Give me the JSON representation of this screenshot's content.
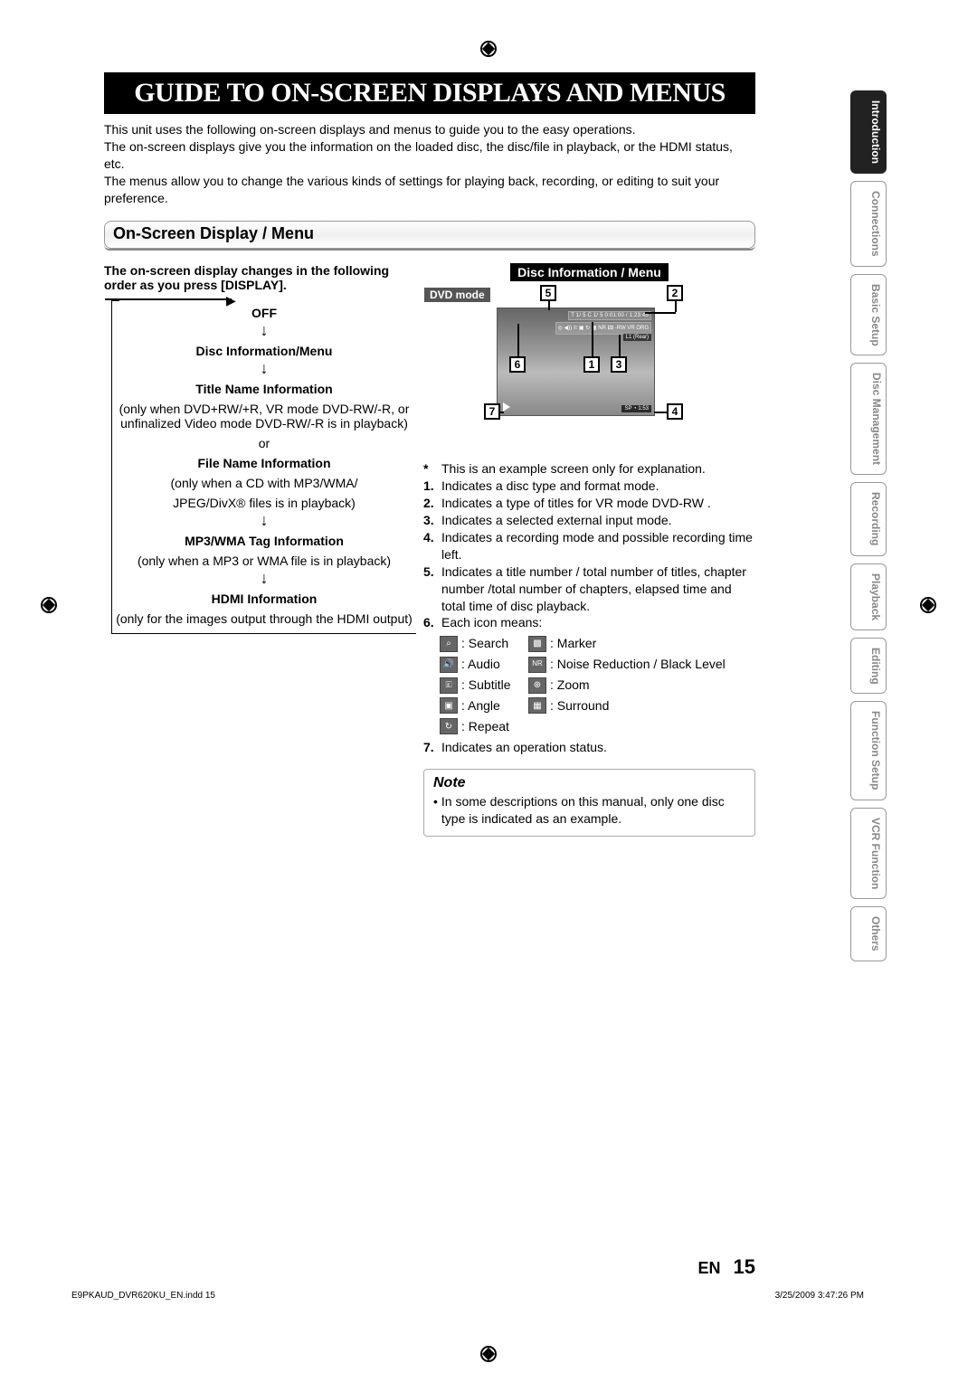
{
  "title": "GUIDE TO ON-SCREEN DISPLAYS AND MENUS",
  "intro": {
    "l1": "This unit uses the following on-screen displays and menus to guide you to the easy operations.",
    "l2": "The on-screen displays give you the information on the loaded disc, the disc/file in playback, or the HDMI status, etc.",
    "l3": "The menus allow you to change the various kinds of settings for playing back, recording, or editing to suit your preference."
  },
  "section_title": "On-Screen Display / Menu",
  "lead": "The on-screen display changes in the following order as you press [DISPLAY].",
  "flow": {
    "off": "OFF",
    "disc_info": "Disc Information/Menu",
    "title_name": "Title Name Information",
    "title_note": "(only when DVD+RW/+R, VR mode DVD-RW/-R, or unfinalized Video mode DVD-RW/-R is in playback)",
    "or": "or",
    "file_name": "File Name Information",
    "file_note1": "(only when a CD with MP3/WMA/",
    "file_note2": "JPEG/DivX® files is in playback)",
    "mp3": "MP3/WMA Tag Information",
    "mp3_note": "(only when a MP3 or WMA file is in playback)",
    "hdmi": "HDMI Information",
    "hdmi_note": "(only for the images output through the HDMI output)"
  },
  "diagram": {
    "header": "Disc Information / Menu",
    "mode": "DVD mode",
    "bar1": "T   1/   5  C   1/   5        0:01:00 / 1:23:45",
    "bar2": "◎ ◀)) 🗉 ▣ ↻ ▦ NR 🖽   -RW  VR  ORG",
    "bar3": "L1 (Rear)",
    "bar4": "SP   ◔   1:53",
    "star_note": "This is an example screen only for explanation.",
    "items": [
      "Indicates a disc type and format mode.",
      "Indicates a type of titles for VR mode DVD-RW .",
      "Indicates a selected external input mode.",
      "Indicates a recording mode and possible recording time left.",
      "Indicates a title number / total number of titles, chapter number /total number of chapters, elapsed time and total time of disc playback.",
      "Each icon means:"
    ],
    "item7": "Indicates an operation status."
  },
  "icons": {
    "search": ": Search",
    "marker": ": Marker",
    "audio": ": Audio",
    "nr": ": Noise Reduction / Black Level",
    "subtitle": ": Subtitle",
    "zoom": ": Zoom",
    "angle": ": Angle",
    "surround": ": Surround",
    "repeat": ": Repeat"
  },
  "note": {
    "title": "Note",
    "body": "In some descriptions on this manual, only one disc type is indicated as an example."
  },
  "side_tabs": [
    "Introduction",
    "Connections",
    "Basic Setup",
    "Disc Management",
    "Recording",
    "Playback",
    "Editing",
    "Function Setup",
    "VCR Function",
    "Others"
  ],
  "page_lang": "EN",
  "page_no": "15",
  "footer_left": "E9PKAUD_DVR620KU_EN.indd   15",
  "footer_right": "3/25/2009   3:47:26 PM"
}
